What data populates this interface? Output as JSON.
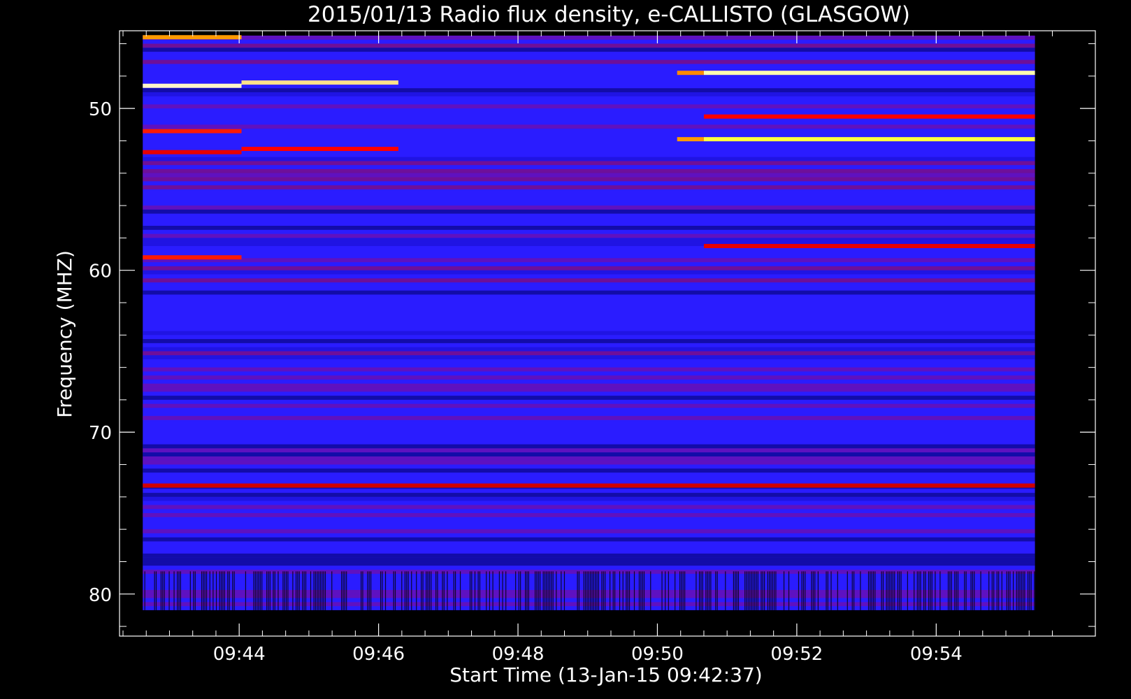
{
  "chart_data": {
    "type": "heatmap",
    "title": "2015/01/13  Radio flux density, e-CALLISTO (GLASGOW)",
    "xlabel": "Start Time (13-Jan-15 09:42:37)",
    "ylabel": "Frequency (MHZ)",
    "xlim": [
      "09:42:17",
      "09:56:17"
    ],
    "ylim": [
      45.2,
      82.6
    ],
    "y_inverted": true,
    "data_time_range": [
      "09:42:37",
      "09:55:25"
    ],
    "data_freq_range": [
      45.5,
      81.0
    ],
    "x_ticks": [
      "09:44",
      "09:46",
      "09:48",
      "09:50",
      "09:52",
      "09:54"
    ],
    "y_ticks": [
      50,
      60,
      70,
      80
    ],
    "colormap": [
      "#000000",
      "#0000ff",
      "#ff0000",
      "#ffff00",
      "#ffffff"
    ],
    "background_color": "#2a1cff",
    "bright_bands_mhz": [
      {
        "t_start": "09:42:37",
        "t_end": "09:44:02",
        "freq": 45.6,
        "color": "#ff9a00"
      },
      {
        "t_start": "09:42:37",
        "t_end": "09:44:02",
        "freq": 48.6,
        "color": "#fff5c8"
      },
      {
        "t_start": "09:42:37",
        "t_end": "09:44:02",
        "freq": 51.4,
        "color": "#ff1a00"
      },
      {
        "t_start": "09:42:37",
        "t_end": "09:44:02",
        "freq": 52.7,
        "color": "#e60000"
      },
      {
        "t_start": "09:42:37",
        "t_end": "09:44:02",
        "freq": 59.2,
        "color": "#ff1a00"
      },
      {
        "t_start": "09:44:02",
        "t_end": "09:46:17",
        "freq": 48.4,
        "color": "#ffe08a"
      },
      {
        "t_start": "09:44:02",
        "t_end": "09:46:17",
        "freq": 52.5,
        "color": "#ff0000"
      },
      {
        "t_start": "09:50:17",
        "t_end": "09:50:40",
        "freq": 47.8,
        "color": "#ff8a00"
      },
      {
        "t_start": "09:50:17",
        "t_end": "09:50:40",
        "freq": 51.9,
        "color": "#ff9a00"
      },
      {
        "t_start": "09:50:40",
        "t_end": "09:55:25",
        "freq": 47.8,
        "color": "#fffbb0"
      },
      {
        "t_start": "09:50:40",
        "t_end": "09:55:25",
        "freq": 50.5,
        "color": "#ff0000"
      },
      {
        "t_start": "09:50:40",
        "t_end": "09:55:25",
        "freq": 51.9,
        "color": "#ffff40"
      },
      {
        "t_start": "09:50:40",
        "t_end": "09:55:25",
        "freq": 58.5,
        "color": "#e60000"
      },
      {
        "t_start": "09:42:37",
        "t_end": "09:55:25",
        "freq": 73.3,
        "color": "#d00000"
      }
    ]
  }
}
